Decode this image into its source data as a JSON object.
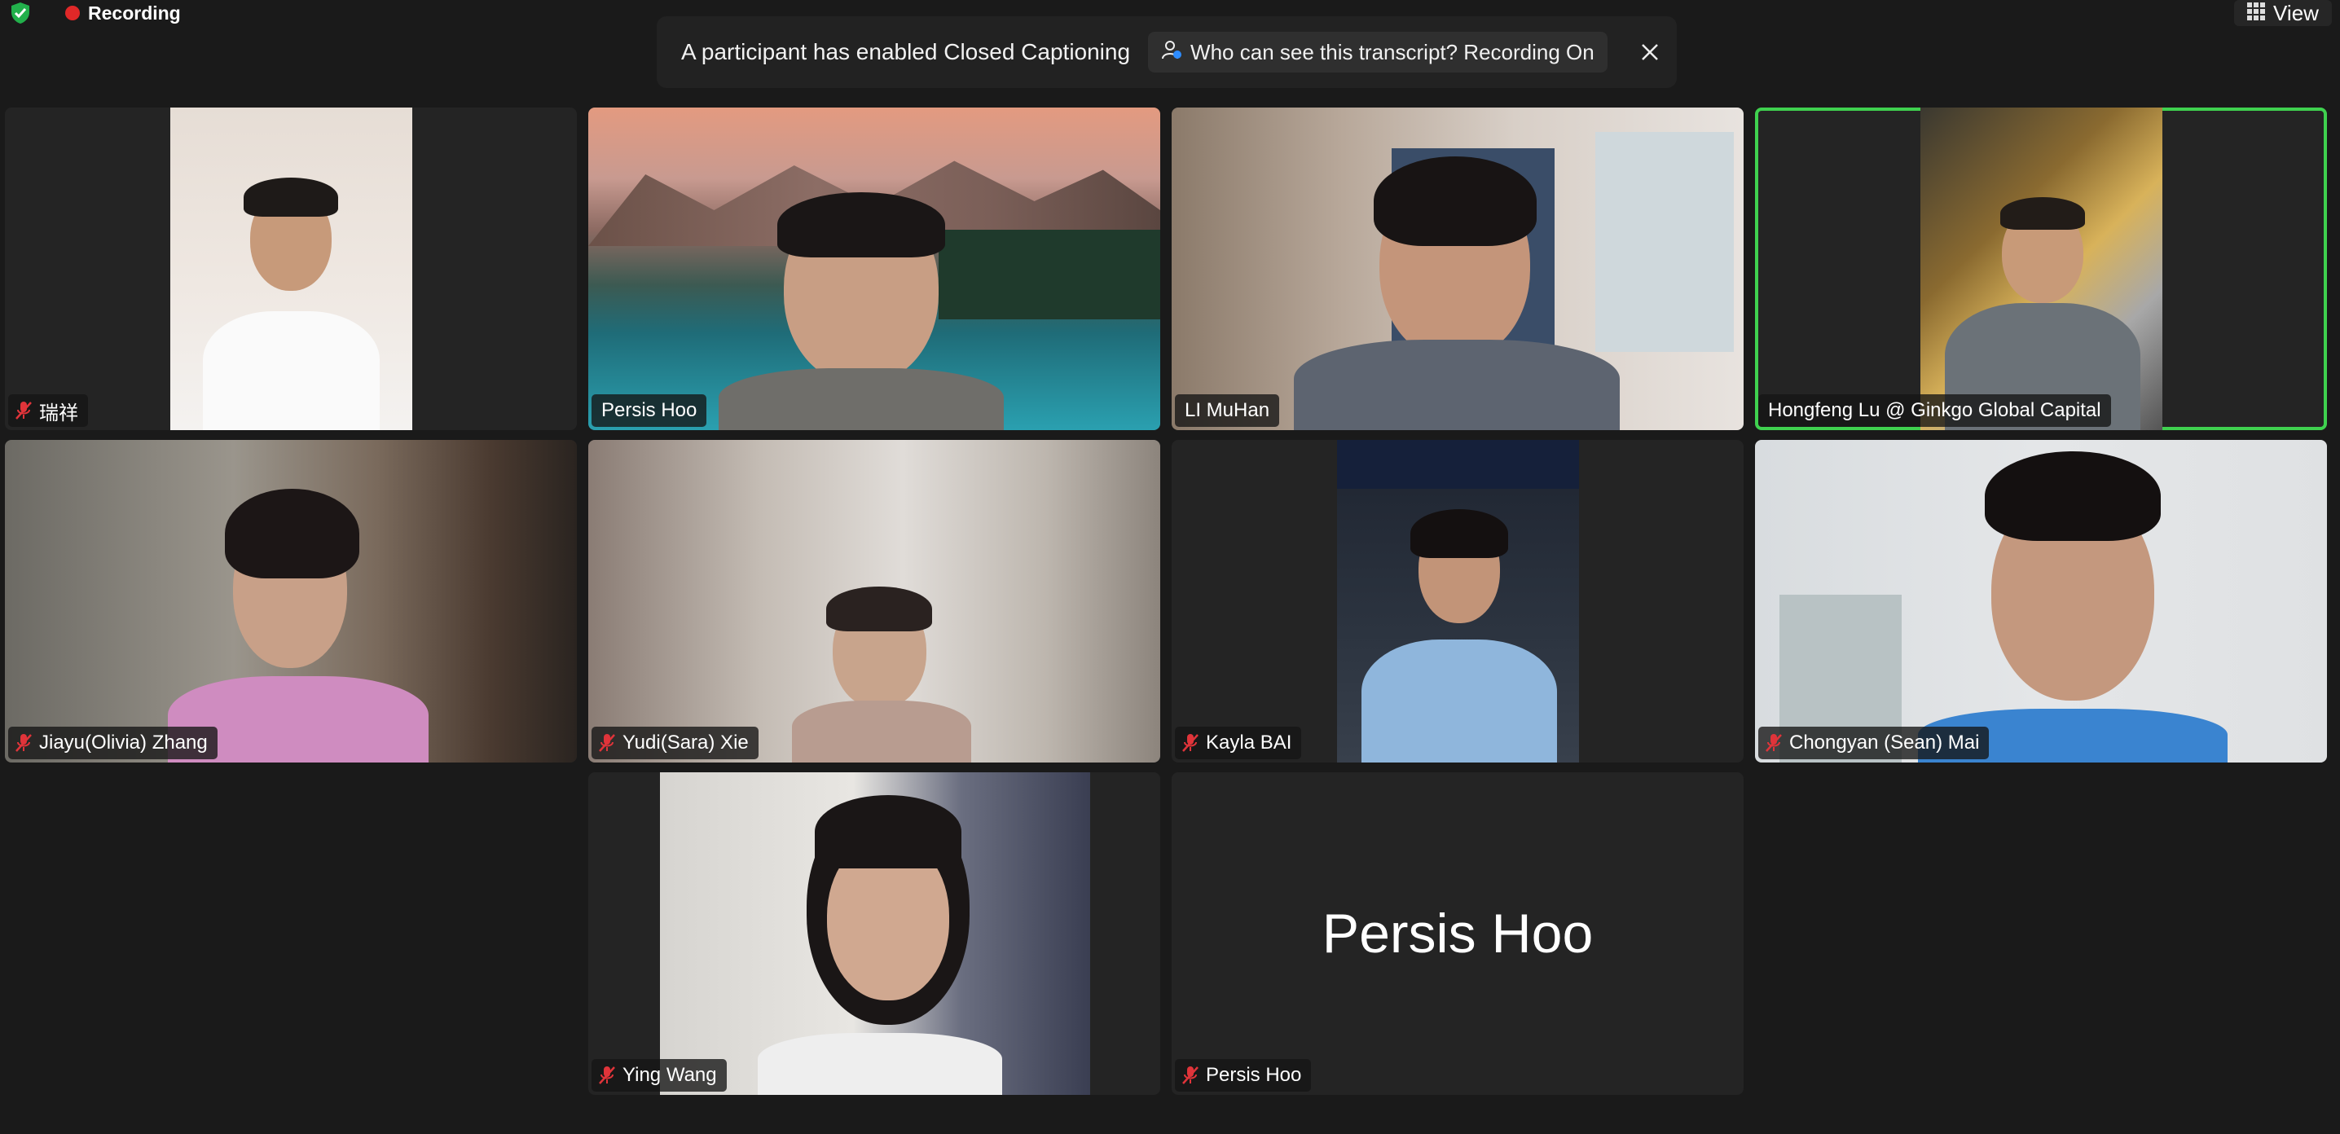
{
  "recording": {
    "label": "Recording"
  },
  "view_button": {
    "label": "View"
  },
  "cc_banner": {
    "message": "A participant has enabled Closed Captioning",
    "transcript_button": "Who can see this transcript? Recording On"
  },
  "participants": [
    {
      "name": "瑞祥",
      "muted": true
    },
    {
      "name": "Persis Hoo",
      "muted": false
    },
    {
      "name": "LI MuHan",
      "muted": false
    },
    {
      "name": "Hongfeng Lu @ Ginkgo Global Capital",
      "muted": false,
      "active_speaker": true
    },
    {
      "name": "Jiayu(Olivia) Zhang",
      "muted": true
    },
    {
      "name": "Yudi(Sara) Xie",
      "muted": true
    },
    {
      "name": "Kayla BAI",
      "muted": true
    },
    {
      "name": "Chongyan (Sean) Mai",
      "muted": true
    },
    {
      "name": "Ying Wang",
      "muted": true
    },
    {
      "name": "Persis Hoo",
      "muted": true,
      "video_off": true,
      "display_name": "Persis Hoo"
    }
  ],
  "colors": {
    "active_border": "#3fd14f",
    "recording_dot": "#e02828",
    "muted_icon": "#e0343a"
  }
}
